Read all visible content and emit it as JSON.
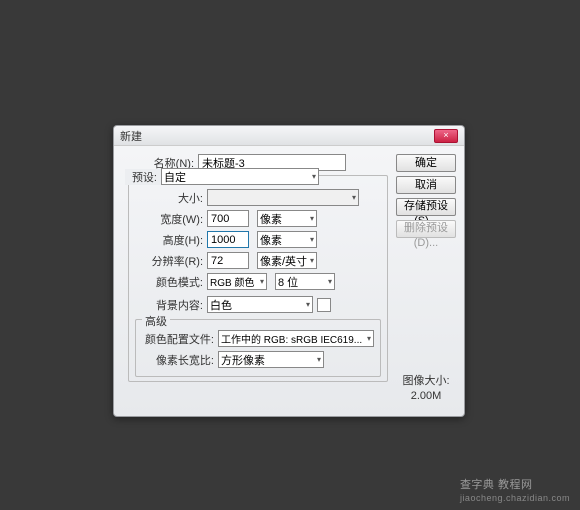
{
  "dialog": {
    "title": "新建",
    "name_label": "名称(N):",
    "name_value": "未标题-3",
    "preset_label": "预设:",
    "preset_value": "自定",
    "size_label": "大小:",
    "width_label": "宽度(W):",
    "width_value": "700",
    "width_unit": "像素",
    "height_label": "高度(H):",
    "height_value": "1000",
    "height_unit": "像素",
    "res_label": "分辨率(R):",
    "res_value": "72",
    "res_unit": "像素/英寸",
    "mode_label": "颜色模式:",
    "mode_value": "RGB 颜色",
    "depth_value": "8 位",
    "bg_label": "背景内容:",
    "bg_value": "白色",
    "advanced_label": "高级",
    "profile_label": "颜色配置文件:",
    "profile_value": "工作中的 RGB: sRGB IEC619...",
    "aspect_label": "像素长宽比:",
    "aspect_value": "方形像素",
    "image_size_label": "图像大小:",
    "image_size_value": "2.00M"
  },
  "buttons": {
    "ok": "确定",
    "cancel": "取消",
    "save_preset": "存储预设(S)...",
    "delete_preset": "删除预设(D)...",
    "close_x": "×"
  },
  "watermark": {
    "main": "查字典 教程网",
    "sub": "jiaocheng.chazidian.com"
  }
}
